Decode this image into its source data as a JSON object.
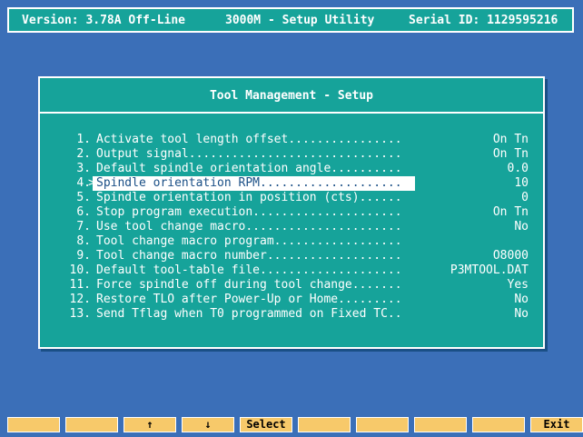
{
  "header": {
    "version": "Version: 3.78A Off-Line",
    "title": "3000M - Setup Utility",
    "serial": "Serial ID: 1129595216"
  },
  "panel": {
    "title": "Tool Management - Setup",
    "items": [
      {
        "num": "1.",
        "label": "Activate tool length offset................",
        "value": "On Tn"
      },
      {
        "num": "2.",
        "label": "Output signal..............................",
        "value": "On Tn"
      },
      {
        "num": "3.",
        "label": "Default spindle orientation angle..........",
        "value": "0.0"
      },
      {
        "num": "4.",
        "label": "Spindle orientation RPM....................",
        "value": "10"
      },
      {
        "num": "5.",
        "label": "Spindle orientation in position (cts)......",
        "value": "0"
      },
      {
        "num": "6.",
        "label": "Stop program execution.....................",
        "value": "On Tn"
      },
      {
        "num": "7.",
        "label": "Use tool change macro......................",
        "value": "No"
      },
      {
        "num": "8.",
        "label": "Tool change macro program..................",
        "value": ""
      },
      {
        "num": "9.",
        "label": "Tool change macro number...................",
        "value": "O8000"
      },
      {
        "num": "10.",
        "label": "Default tool-table file....................",
        "value": "P3MTOOL.DAT"
      },
      {
        "num": "11.",
        "label": "Force spindle off during tool change.......",
        "value": "Yes"
      },
      {
        "num": "12.",
        "label": "Restore TLO after Power-Up or Home.........",
        "value": "No"
      },
      {
        "num": "13.",
        "label": "Send Tflag when T0 programmed on Fixed TC..",
        "value": "No"
      }
    ],
    "selected_index": 3,
    "selection_arrow": ">"
  },
  "fkeys": [
    "",
    "",
    "↑",
    "↓",
    "Select",
    "",
    "",
    "",
    "",
    "Exit"
  ],
  "colors": {
    "background": "#3b6fb8",
    "panel": "#16a39a",
    "fkey": "#f7c96a",
    "selected_text": "#1a4f86"
  }
}
